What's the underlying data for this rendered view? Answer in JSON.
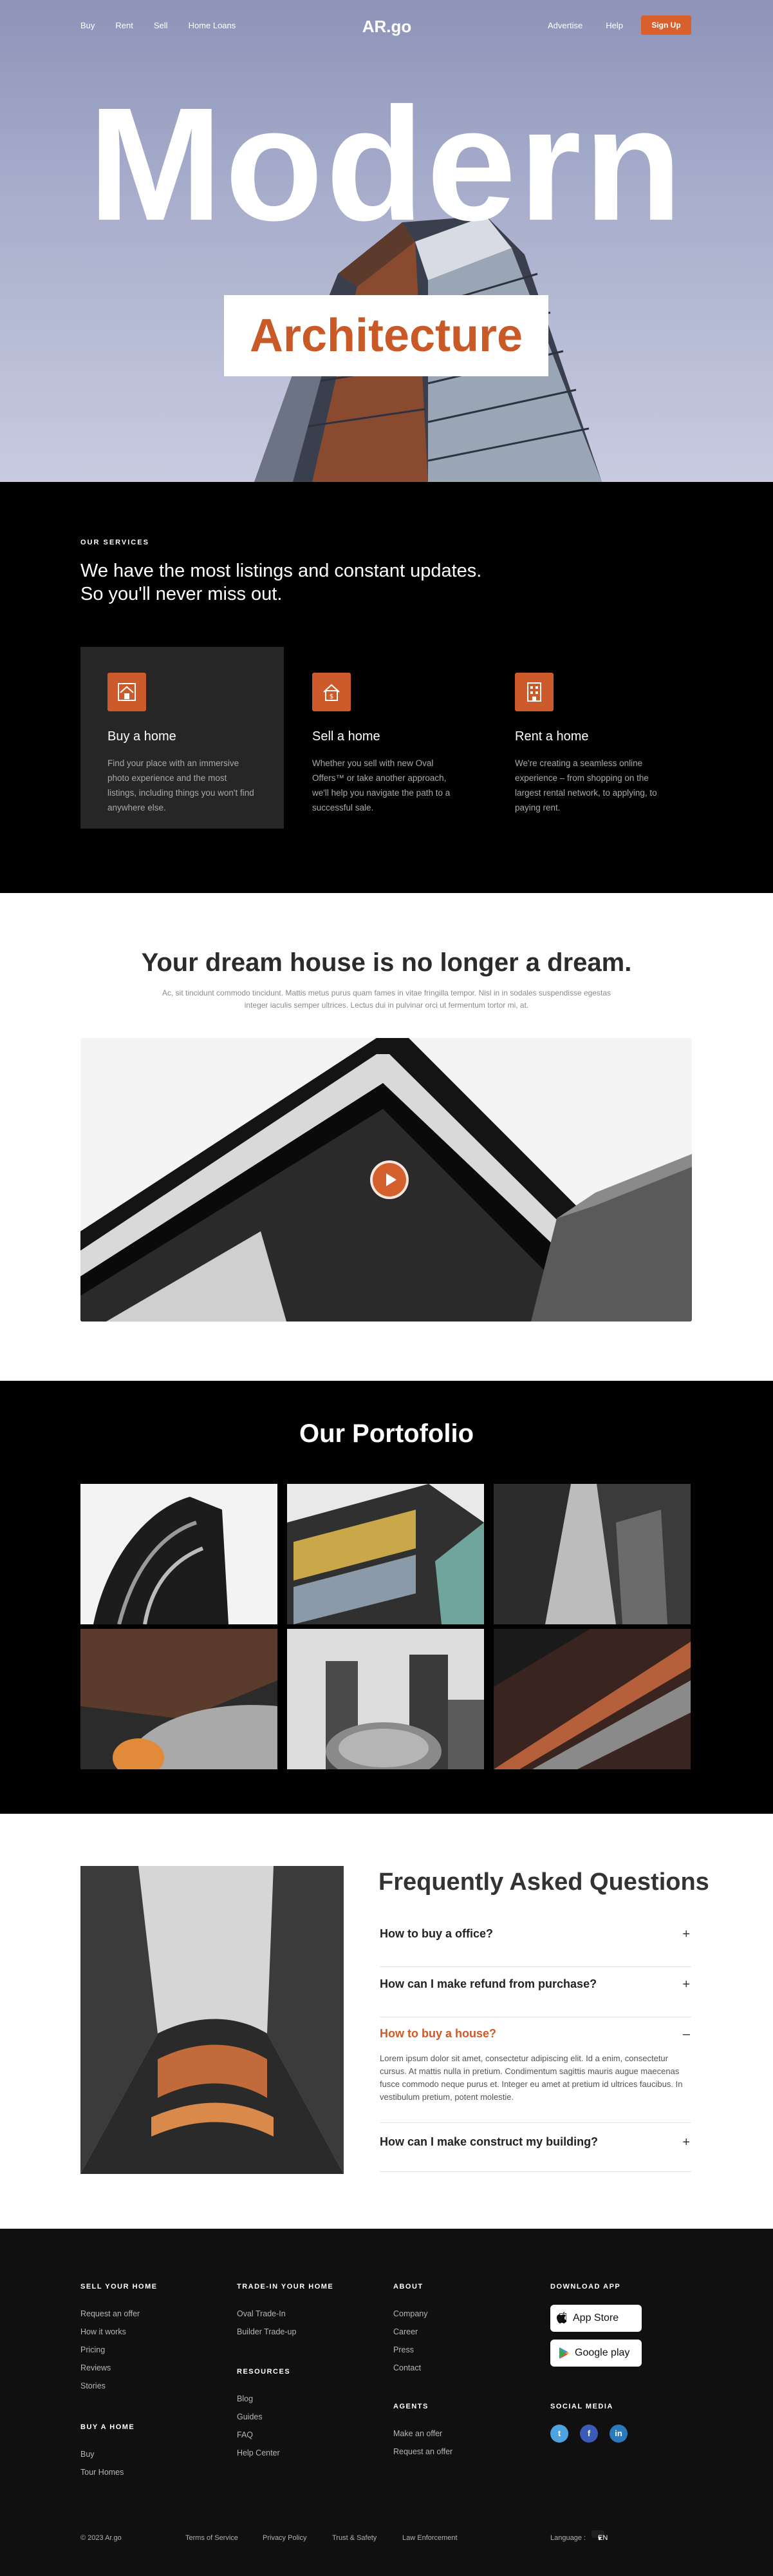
{
  "nav": {
    "left": [
      "Buy",
      "Rent",
      "Sell",
      "Home Loans"
    ],
    "logo": "AR.go",
    "right": [
      "Advertise",
      "Help"
    ],
    "signup": "Sign Up"
  },
  "hero": {
    "title": "Modern",
    "subtitle": "Architecture"
  },
  "services": {
    "eyebrow": "OUR SERVICES",
    "heading_line1": "We have the most listings and constant updates.",
    "heading_line2": "So you'll never miss out.",
    "cards": [
      {
        "title": "Buy a home",
        "text": "Find your place with an immersive photo experience and the most listings, including things you won't find anywhere else.",
        "icon": "house-icon"
      },
      {
        "title": "Sell a home",
        "text": "Whether you sell with new Oval Offers™ or take another approach, we'll help you navigate the path to a successful sale.",
        "icon": "sell-house-icon"
      },
      {
        "title": "Rent a home",
        "text": "We're creating a seamless online experience – from shopping on the largest rental network, to applying, to paying rent.",
        "icon": "building-icon"
      }
    ]
  },
  "dream": {
    "title": "Your dream house is no longer a dream.",
    "text": "Ac, sit tincidunt commodo tincidunt. Mattis metus purus quam fames in vitae fringilla tempor. Nisl in in sodales suspendisse egestas integer iaculis semper ultrices. Lectus dui in pulvinar orci ut fermentum tortor mi, at."
  },
  "portfolio": {
    "title": "Our Portofolio"
  },
  "faq": {
    "title": "Frequently Asked Questions",
    "items": [
      {
        "q": "How to buy a office?",
        "sign": "+"
      },
      {
        "q": "How can I make refund from purchase?",
        "sign": "+"
      },
      {
        "q": "How to buy a house?",
        "sign": "–",
        "a": "Lorem ipsum dolor sit amet, consectetur adipiscing elit. Id a enim, consectetur cursus. At mattis nulla in pretium. Condimentum sagittis mauris augue maecenas fusce commodo neque purus et. Integer eu amet at pretium id ultrices faucibus. In vestibulum pretium, potent molestie."
      },
      {
        "q": "How can I make construct my building?",
        "sign": "+"
      }
    ]
  },
  "footer": {
    "sell": {
      "head": "SELL YOUR HOME",
      "links": [
        "Request an offer",
        "How it works",
        "Pricing",
        "Reviews",
        "Stories"
      ]
    },
    "buy": {
      "head": "BUY A HOME",
      "links": [
        "Buy",
        "Tour Homes"
      ]
    },
    "trade": {
      "head": "TRADE-IN YOUR HOME",
      "links": [
        "Oval Trade-In",
        "Builder Trade-up"
      ]
    },
    "resources": {
      "head": "RESOURCES",
      "links": [
        "Blog",
        "Guides",
        "FAQ",
        "Help Center"
      ]
    },
    "about": {
      "head": "ABOUT",
      "links": [
        "Company",
        "Career",
        "Press",
        "Contact"
      ]
    },
    "agents": {
      "head": "AGENTS",
      "links": [
        "Make an offer",
        "Request an offer"
      ]
    },
    "download": {
      "head": "DOWNLOAD APP",
      "appstore": "App Store",
      "googleplay": "Google play"
    },
    "social": {
      "head": "SOCIAL MEDIA",
      "icons": [
        "twitter-icon",
        "facebook-icon",
        "linkedin-icon"
      ]
    },
    "bottom": {
      "copyright": "© 2023 Ar.go",
      "links": [
        "Terms of Service",
        "Privacy Policy",
        "Trust & Safety",
        "Law Enforcement"
      ],
      "language_label": "Language :",
      "language_value": "EN"
    }
  },
  "colors": {
    "accent": "#d7602d",
    "dark": "#000000"
  }
}
